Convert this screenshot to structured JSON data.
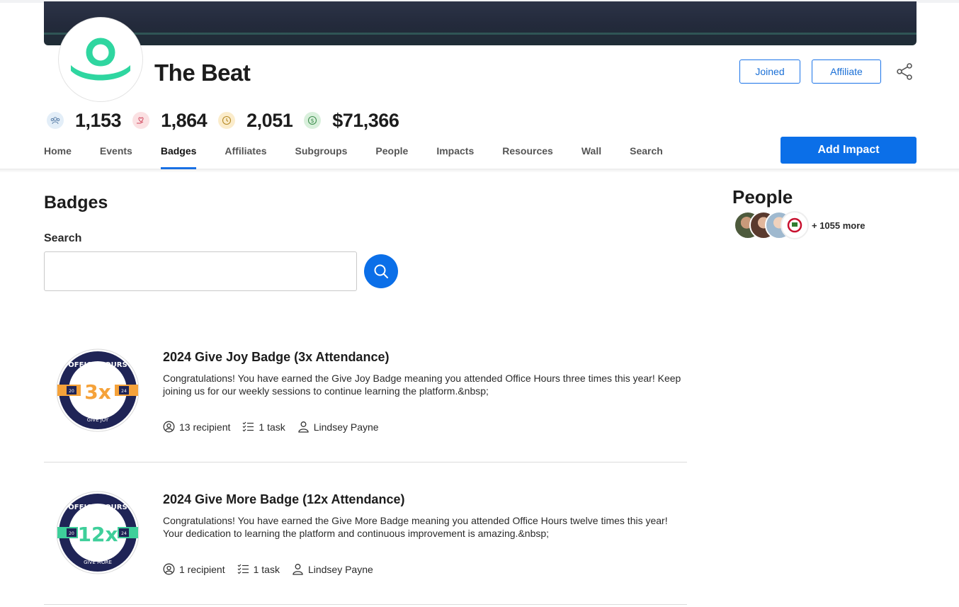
{
  "group": {
    "name": "The Beat",
    "joined_label": "Joined",
    "affiliate_label": "Affiliate"
  },
  "stats": {
    "members": "1,153",
    "likes": "1,864",
    "hours": "2,051",
    "dollars": "$71,366"
  },
  "nav": {
    "tabs": [
      "Home",
      "Events",
      "Badges",
      "Affiliates",
      "Subgroups",
      "People",
      "Impacts",
      "Resources",
      "Wall",
      "Search"
    ],
    "active": "Badges",
    "add_impact_label": "Add Impact"
  },
  "badges_section": {
    "title": "Badges",
    "search_label": "Search",
    "search_value": "",
    "items": [
      {
        "title": "2024 Give Joy Badge (3x Attendance)",
        "description": "Congratulations! You have earned the Give Joy Badge meaning you attended Office Hours three times this year! Keep joining us for our weekly sessions to continue learning the platform.&nbsp;",
        "recipients": "13 recipient",
        "tasks": "1 task",
        "author": "Lindsey Payne",
        "emblem": {
          "top_text": "OFFICE HOURS",
          "center": "3x",
          "year_left": "20",
          "year_right": "24",
          "bottom_text": "GIVE JOY",
          "accent": "#f5a23a"
        }
      },
      {
        "title": "2024 Give More Badge (12x Attendance)",
        "description": "Congratulations! You have earned the Give More Badge meaning you attended Office Hours twelve times this year! Your dedication to learning the platform and continuous improvement is amazing.&nbsp;",
        "recipients": "1 recipient",
        "tasks": "1 task",
        "author": "Lindsey Payne",
        "emblem": {
          "top_text": "OFFICE HOURS",
          "center": "12x",
          "year_left": "20",
          "year_right": "24",
          "bottom_text": "GIVE MORE",
          "accent": "#3ecf9a"
        }
      }
    ]
  },
  "people": {
    "title": "People",
    "more_label": "+ 1055 more"
  },
  "colors": {
    "primary": "#0b6fe8",
    "brand_green": "#2fd6a0",
    "badge_navy": "#1f2456"
  }
}
